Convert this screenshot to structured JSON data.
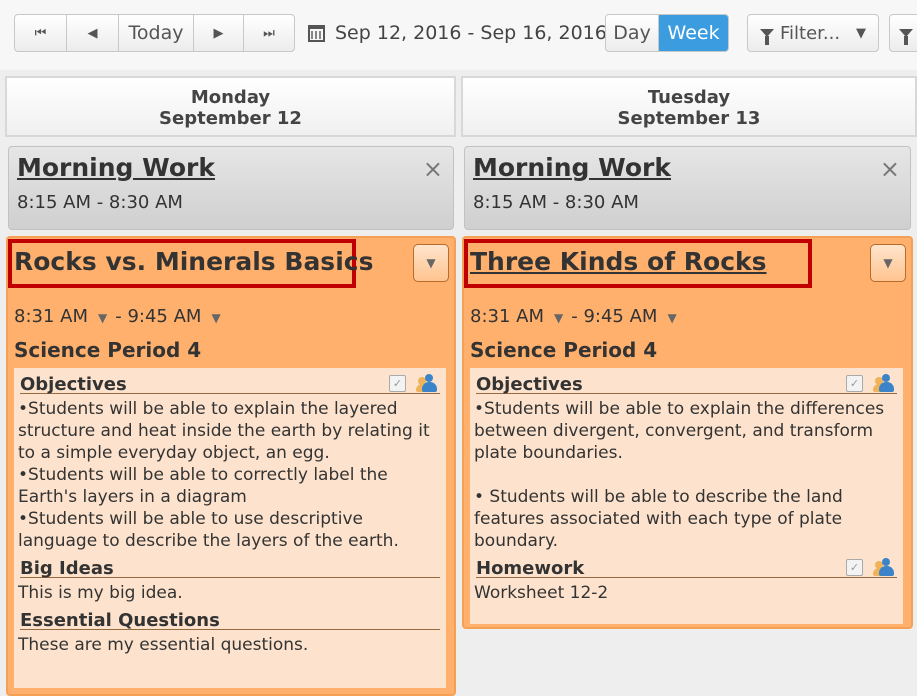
{
  "toolbar": {
    "first_icon": "⏮",
    "prev_icon": "◀",
    "today_label": "Today",
    "next_icon": "▶",
    "last_icon": "⏭",
    "date_range": "Sep 12, 2016 - Sep 16, 2016",
    "day_label": "Day",
    "week_label": "Week",
    "filter_label": "Filter...",
    "caret": "▼"
  },
  "colors": {
    "accent": "#3c9ce0",
    "lesson": "#ffb06c",
    "lesson_body": "#fde3cd",
    "highlight_border": "#c00000"
  },
  "columns": [
    {
      "day": "Monday",
      "date": "September 12",
      "morning": {
        "title": "Morning Work",
        "time": "8:15 AM - 8:30 AM",
        "close": "×"
      },
      "lesson": {
        "title": "Rocks vs. Minerals Basics",
        "start": "8:31 AM",
        "end": "- 9:45 AM",
        "period": "Science Period 4",
        "sections": [
          {
            "heading": "Objectives",
            "lines": [
              "•Students will be able to explain the layered structure and heat inside the earth by relating it to a simple everyday object, an egg.",
              "•Students will be able to correctly label the Earth's layers in a diagram",
              "•Students will be able to use descriptive language to describe the layers of the earth."
            ]
          },
          {
            "heading": "Big Ideas",
            "lines": [
              "This is my big idea."
            ]
          },
          {
            "heading": "Essential Questions",
            "lines": [
              "These are my essential questions."
            ]
          }
        ]
      }
    },
    {
      "day": "Tuesday",
      "date": "September 13",
      "morning": {
        "title": "Morning Work",
        "time": "8:15 AM - 8:30 AM",
        "close": "×"
      },
      "lesson": {
        "title": "Three Kinds of Rocks",
        "start": "8:31 AM",
        "end": "- 9:45 AM",
        "period": "Science Period 4",
        "sections": [
          {
            "heading": "Objectives",
            "lines": [
              "•Students will be able to explain the differences between divergent, convergent, and transform plate boundaries.",
              "• Students will be able to describe the land features associated with each type of plate boundary."
            ]
          },
          {
            "heading": "Homework",
            "lines": [
              "Worksheet 12-2"
            ]
          }
        ]
      }
    }
  ]
}
